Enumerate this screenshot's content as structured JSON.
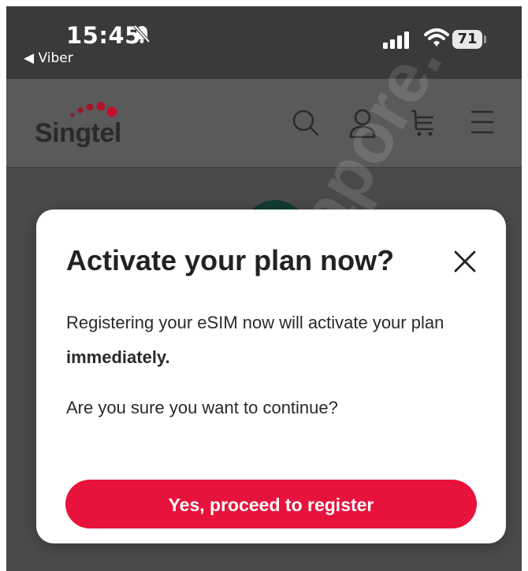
{
  "status_bar": {
    "time": "15:45",
    "back_app": "◀ Viber",
    "battery": "71"
  },
  "header": {
    "logo": "Singtel",
    "icons": [
      "search-icon",
      "account-icon",
      "cart-icon",
      "menu-icon"
    ]
  },
  "modal": {
    "title": "Activate your plan now?",
    "body_text": "Registering your eSIM now will activate your plan ",
    "body_bold": "immediately.",
    "question": "Are you sure you want to continue?",
    "cta_label": "Yes, proceed to register"
  },
  "watermark": "apore.",
  "colors": {
    "brand_red": "#e8133d",
    "dot_red": "#c4102f",
    "header_dim": "#5a5a5a",
    "overlay": "#4a4a4a"
  },
  "battery_level": 0.71
}
